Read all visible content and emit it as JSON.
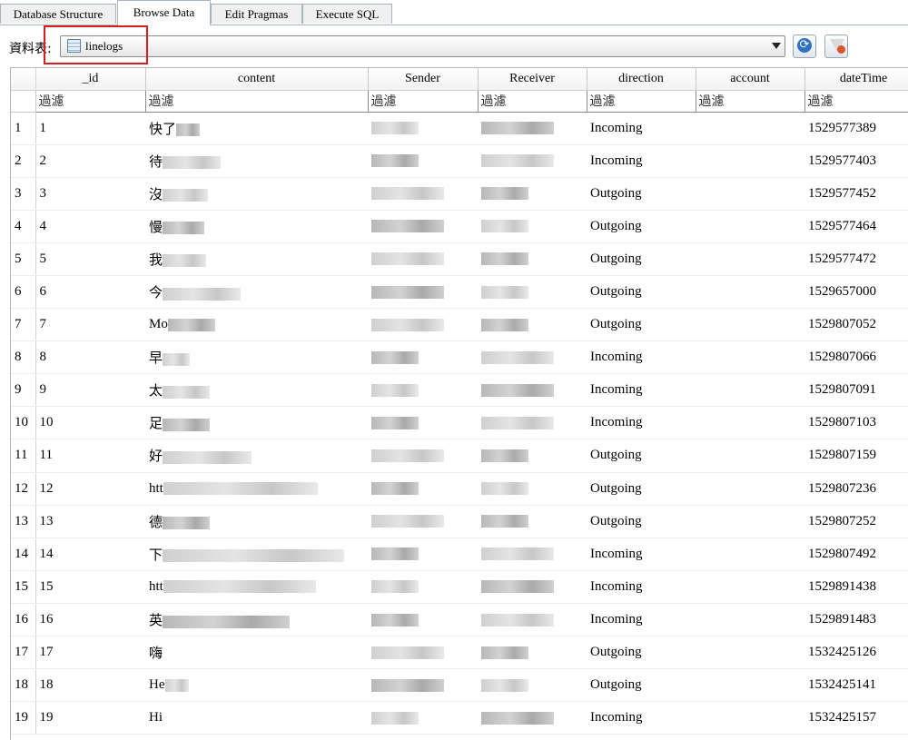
{
  "tabs": [
    {
      "label": "Database Structure",
      "active": false
    },
    {
      "label": "Browse Data",
      "active": true
    },
    {
      "label": "Edit Pragmas",
      "active": false
    },
    {
      "label": "Execute SQL",
      "active": false
    }
  ],
  "toolbar": {
    "table_label": "資料表:",
    "selected_table": "linelogs",
    "table_icon": "table-icon",
    "refresh_icon": "refresh-icon",
    "clear_filter_icon": "clear-filter-icon"
  },
  "grid": {
    "columns": [
      "_id",
      "content",
      "Sender",
      "Receiver",
      "direction",
      "account",
      "dateTime"
    ],
    "filter_placeholder": "過濾",
    "rows": [
      {
        "n": "1",
        "id": "1",
        "content": "快了",
        "direction": "Incoming",
        "dateTime": "1529577389"
      },
      {
        "n": "2",
        "id": "2",
        "content": "待",
        "direction": "Incoming",
        "dateTime": "1529577403"
      },
      {
        "n": "3",
        "id": "3",
        "content": "沒",
        "direction": "Outgoing",
        "dateTime": "1529577452"
      },
      {
        "n": "4",
        "id": "4",
        "content": "慢",
        "direction": "Outgoing",
        "dateTime": "1529577464"
      },
      {
        "n": "5",
        "id": "5",
        "content": "我",
        "direction": "Outgoing",
        "dateTime": "1529577472"
      },
      {
        "n": "6",
        "id": "6",
        "content": "今",
        "direction": "Outgoing",
        "dateTime": "1529657000"
      },
      {
        "n": "7",
        "id": "7",
        "content": "Mo",
        "direction": "Outgoing",
        "dateTime": "1529807052"
      },
      {
        "n": "8",
        "id": "8",
        "content": "早",
        "direction": "Incoming",
        "dateTime": "1529807066"
      },
      {
        "n": "9",
        "id": "9",
        "content": "太",
        "direction": "Incoming",
        "dateTime": "1529807091"
      },
      {
        "n": "10",
        "id": "10",
        "content": "足",
        "direction": "Incoming",
        "dateTime": "1529807103"
      },
      {
        "n": "11",
        "id": "11",
        "content": "好",
        "direction": "Outgoing",
        "dateTime": "1529807159"
      },
      {
        "n": "12",
        "id": "12",
        "content": "htt",
        "direction": "Outgoing",
        "dateTime": "1529807236"
      },
      {
        "n": "13",
        "id": "13",
        "content": "德",
        "direction": "Outgoing",
        "dateTime": "1529807252"
      },
      {
        "n": "14",
        "id": "14",
        "content": "下",
        "direction": "Incoming",
        "dateTime": "1529807492"
      },
      {
        "n": "15",
        "id": "15",
        "content": "htt",
        "direction": "Incoming",
        "dateTime": "1529891438"
      },
      {
        "n": "16",
        "id": "16",
        "content": "英",
        "direction": "Incoming",
        "dateTime": "1529891483"
      },
      {
        "n": "17",
        "id": "17",
        "content": "嗨",
        "direction": "Outgoing",
        "dateTime": "1532425126"
      },
      {
        "n": "18",
        "id": "18",
        "content": "He",
        "direction": "Outgoing",
        "dateTime": "1532425141"
      },
      {
        "n": "19",
        "id": "19",
        "content": "Hi",
        "direction": "Incoming",
        "dateTime": "1532425157"
      }
    ]
  }
}
